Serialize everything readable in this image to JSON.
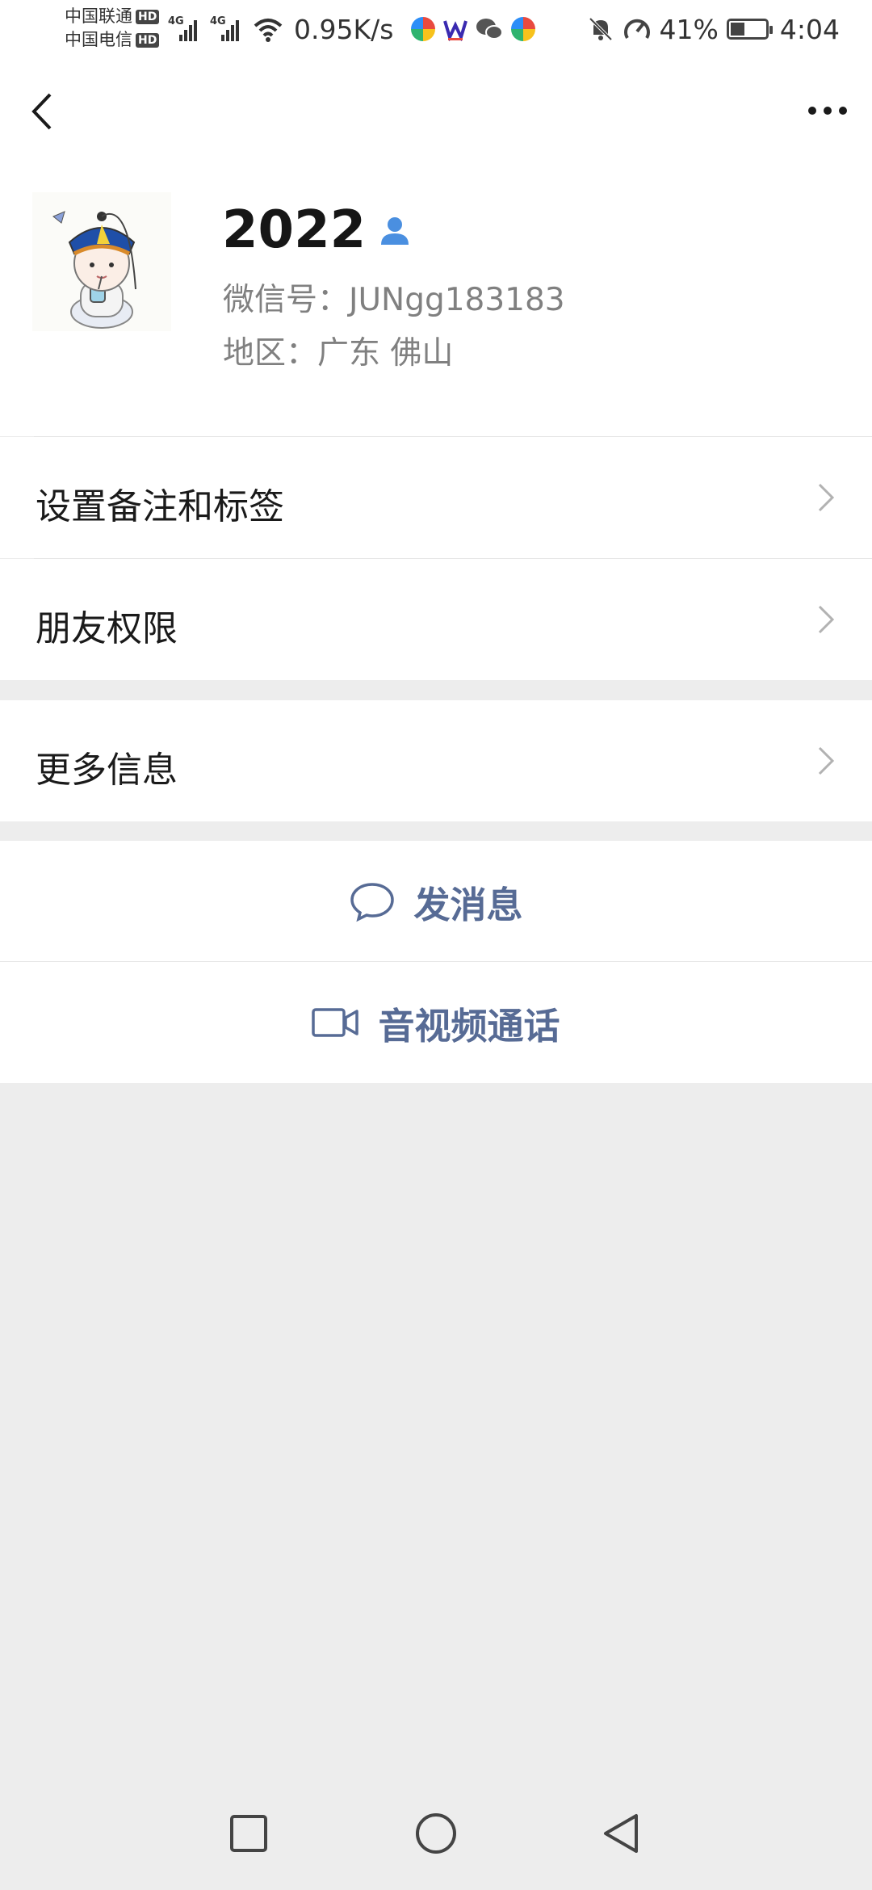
{
  "status_bar": {
    "carrier_1": "中国联通",
    "carrier_2": "中国电信",
    "hd_badge": "HD",
    "signal_tag": "4G",
    "net_speed": "0.95K/s",
    "battery_percent": "41%",
    "battery_level": 0.41,
    "time": "4:04",
    "app_icons": [
      "pinwheel-app-icon",
      "w-app-icon",
      "wechat-icon",
      "pinwheel-app-icon"
    ]
  },
  "nav": {
    "back_icon": "chevron-left-icon",
    "more_icon": "more-horizontal-icon"
  },
  "profile": {
    "name": "2022",
    "wechat_id": "微信号：JUNgg183183",
    "region": "地区：广东  佛山",
    "contact_icon": "person-icon"
  },
  "menu": {
    "remark_tags": "设置备注和标签",
    "friend_permissions": "朋友权限",
    "more_info": "更多信息"
  },
  "actions": {
    "send_message": "发消息",
    "av_call": "音视频通话"
  },
  "colors": {
    "link_blue": "#576b95",
    "background_gray": "#ededed",
    "surface": "#ffffff",
    "contact_icon_blue": "#4a8fe0"
  }
}
